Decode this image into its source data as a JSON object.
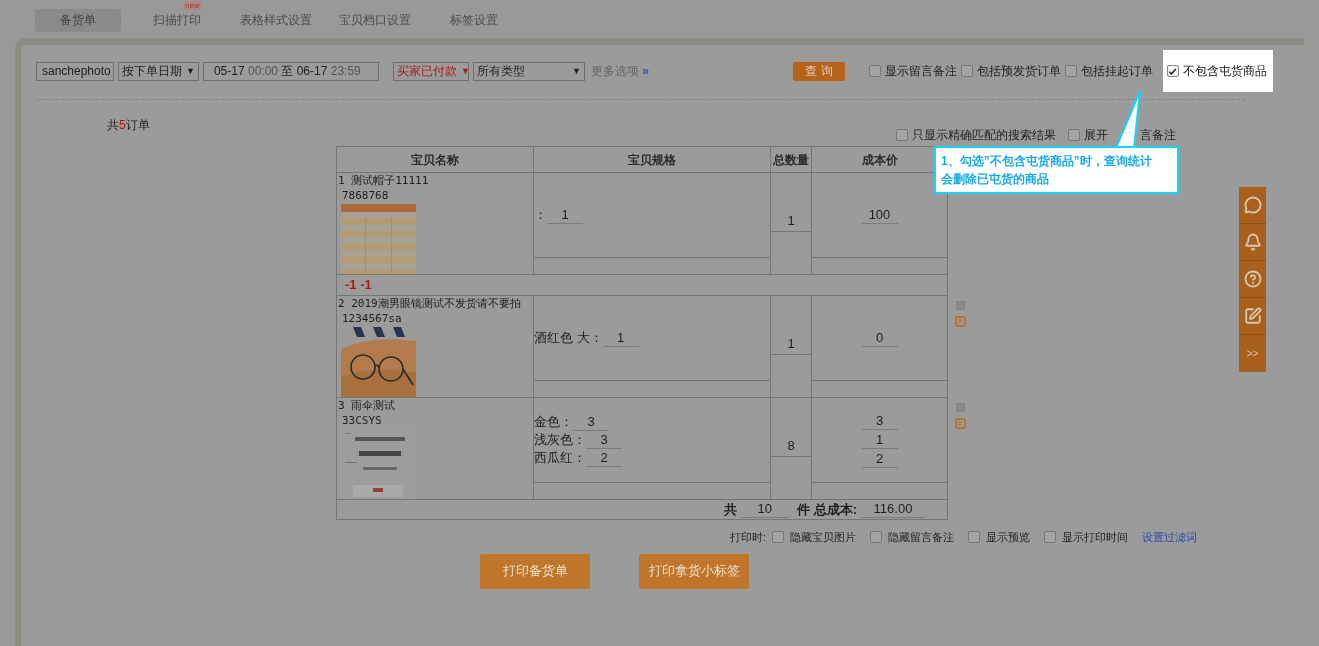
{
  "tabs": [
    {
      "label": "备货单",
      "selected": true
    },
    {
      "label": "扫描打印",
      "selected": false,
      "badge": "new"
    },
    {
      "label": "表格样式设置",
      "selected": false
    },
    {
      "label": "宝贝档口设置",
      "selected": false
    },
    {
      "label": "标签设置",
      "selected": false
    }
  ],
  "filters": {
    "account": "sanchephoto",
    "date_type": "按下单日期",
    "date_type_arrow": "▼",
    "status_arrow": "▼",
    "type_arrow": "▼",
    "date_from": "05-17",
    "time_from": "00:00",
    "date_separator": "至",
    "date_to": "06-17",
    "time_to": "23:59",
    "status": "买家已付款",
    "type": "所有类型",
    "more_link": "更多选项",
    "more_icon": "»",
    "query_button": "查 询"
  },
  "options": [
    {
      "label": "显示留言备注",
      "checked": false,
      "highlighted": false
    },
    {
      "label": "包括预发货订单",
      "checked": false,
      "highlighted": false
    },
    {
      "label": "包括挂起订单",
      "checked": false,
      "highlighted": false
    },
    {
      "label": "不包含屯货商品",
      "checked": true,
      "highlighted": true
    }
  ],
  "summary": {
    "prefix": "共",
    "count": "5",
    "suffix": "订单"
  },
  "result_options": [
    {
      "label": "只显示精确匹配的搜索结果",
      "checked": false
    },
    {
      "label": "展开",
      "label_after": "言备注",
      "checked": false
    }
  ],
  "callout": {
    "lines": [
      "1、勾选”不包含屯货商品”时，查询统计",
      "会删除已屯货的商品"
    ]
  },
  "table": {
    "columns": [
      "宝贝名称",
      "宝贝规格",
      "总数量",
      "成本价"
    ],
    "rows": [
      {
        "index": "1",
        "name": "测试帽子11111",
        "code": "7868768",
        "specs": [
          {
            "label": "：",
            "qty": "1"
          }
        ],
        "total_qty": "1",
        "costs": [
          "100"
        ],
        "note": "-1 -1",
        "side_controls": false
      },
      {
        "index": "2",
        "name": "2019潮男眼镜测试不发货请不要拍",
        "code": "1234567sa",
        "specs": [
          {
            "label": "酒红色 大：",
            "qty": "1"
          }
        ],
        "total_qty": "1",
        "costs": [
          "0"
        ],
        "side_controls": true
      },
      {
        "index": "3",
        "name": "雨伞测试",
        "code": "33CSYS",
        "specs": [
          {
            "label": "金色：",
            "qty": "3"
          },
          {
            "label": "浅灰色：",
            "qty": "3"
          },
          {
            "label": "西瓜红：",
            "qty": "2"
          }
        ],
        "total_qty": "8",
        "costs": [
          "3",
          "1",
          "2"
        ],
        "side_controls": true
      }
    ],
    "total": {
      "prefix": "共",
      "qty": "10",
      "unit": "件",
      "cost_label": "总成本:",
      "cost": "116.00"
    }
  },
  "print_options": {
    "label": "打印时:",
    "items": [
      {
        "label": "隐藏宝贝图片",
        "checked": false
      },
      {
        "label": "隐藏留言备注",
        "checked": false
      },
      {
        "label": "显示预览",
        "checked": false
      },
      {
        "label": "显示打印时间",
        "checked": false
      }
    ],
    "link": "设置过滤词"
  },
  "buttons": [
    "打印备货单",
    "打印拿货小标签"
  ],
  "side_panel": {
    "more": ">>"
  }
}
